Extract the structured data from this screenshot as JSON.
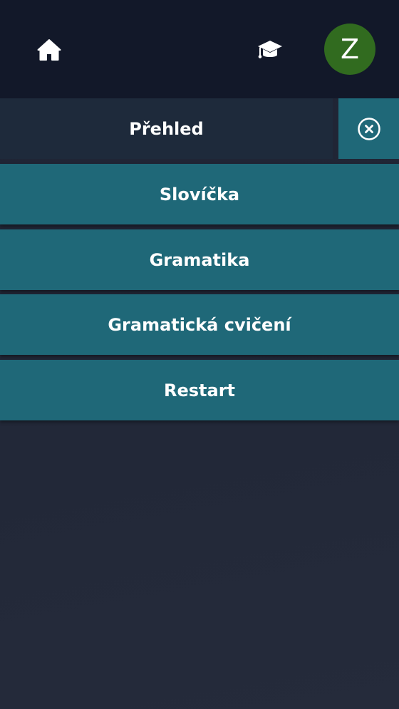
{
  "header": {
    "home_icon": "home-icon",
    "courses_icon": "graduation-cap-icon",
    "avatar_letter": "Z",
    "avatar_color": "#316b1f",
    "background_color": "#121829"
  },
  "nav": {
    "overview_label": "Přehled",
    "close_icon": "close-circle-icon",
    "items": [
      {
        "label": "Slovíčka"
      },
      {
        "label": "Gramatika"
      },
      {
        "label": "Gramatická cvičení"
      },
      {
        "label": "Restart"
      }
    ]
  },
  "colors": {
    "accent": "#1f6878",
    "overview_bg": "#1e2a3b",
    "page_bg": "#222838",
    "text": "#ffffff"
  }
}
